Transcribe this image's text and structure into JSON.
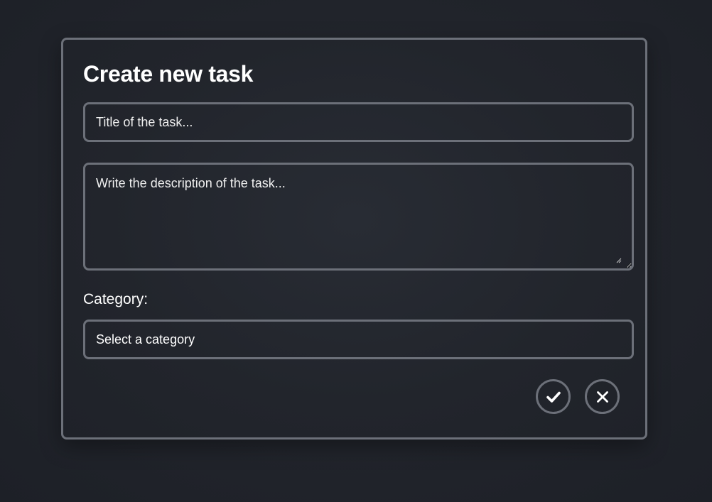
{
  "form": {
    "title": "Create new task",
    "title_placeholder": "Title of the task...",
    "description_placeholder": "Write the description of the task...",
    "category_label": "Category:",
    "category_selected": "Select a category"
  },
  "actions": {
    "confirm_icon": "check-icon",
    "cancel_icon": "close-icon"
  },
  "colors": {
    "background": "#22252c",
    "border": "#6c7079",
    "text": "#ffffff"
  }
}
